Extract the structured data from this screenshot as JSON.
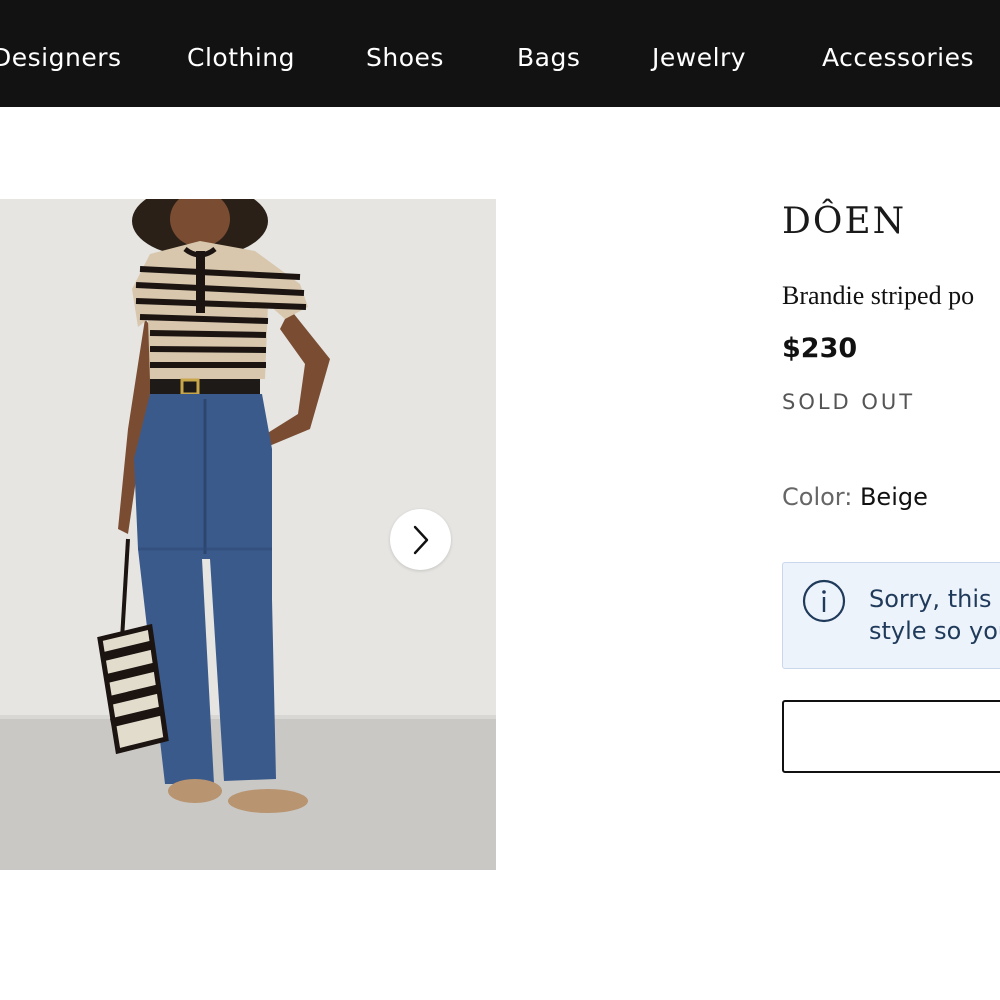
{
  "nav": {
    "items": [
      "Designers",
      "Clothing",
      "Shoes",
      "Bags",
      "Jewelry",
      "Accessories"
    ]
  },
  "product": {
    "brand": "DÔEN",
    "name": "Brandie striped po",
    "price": "$230",
    "stock_status": "SOLD OUT",
    "color_label": "Color:",
    "color_value": "Beige",
    "notice_text": "Sorry, this i\nstyle so you",
    "notice_icon": "info-icon",
    "carousel_icon": "chevron-right-icon"
  },
  "colors": {
    "nav_bg": "#121212",
    "notice_bg": "#edf3fa",
    "notice_text": "#1f3a5a"
  }
}
